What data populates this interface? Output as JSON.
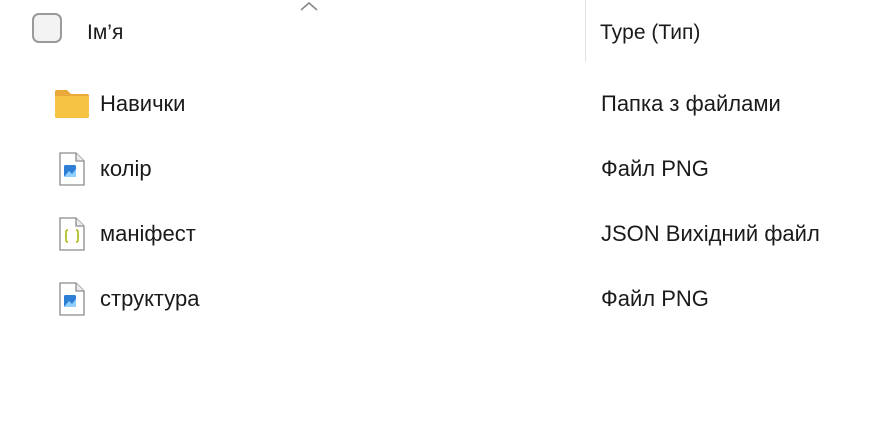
{
  "header": {
    "name_label": "Ім’я",
    "type_label": "Type (Тип)",
    "sort_icon": "chevron-up-icon"
  },
  "files": [
    {
      "name": "Навички",
      "type": "Папка з файлами",
      "icon": "folder-icon"
    },
    {
      "name": "колір",
      "type": "Файл PNG",
      "icon": "image-file-icon"
    },
    {
      "name": "маніфест",
      "type": "JSON Вихідний файл",
      "icon": "json-file-icon"
    },
    {
      "name": "структура",
      "type": "Файл PNG",
      "icon": "image-file-icon"
    }
  ],
  "colors": {
    "folder": "#f6c343",
    "image_accent": "#2f7fd6",
    "json_accent": "#a8b500",
    "divider": "#e2e2e2"
  }
}
